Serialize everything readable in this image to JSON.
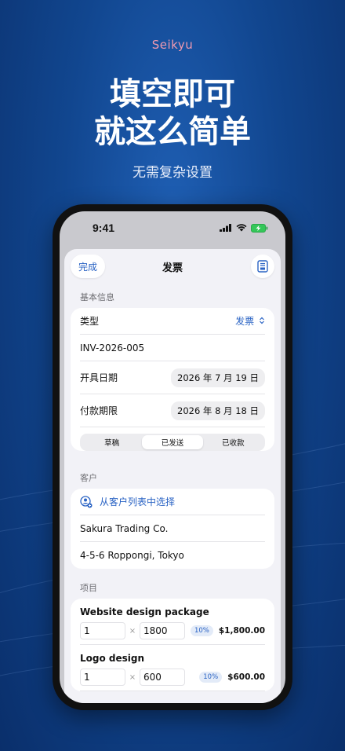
{
  "promo": {
    "brand": "Seikyu",
    "headline_line1": "填空即可",
    "headline_line2": "就这么简单",
    "subheadline": "无需复杂设置"
  },
  "status_bar": {
    "time": "9:41"
  },
  "nav": {
    "done_label": "完成",
    "title": "发票",
    "right_icon": "document-preview-icon"
  },
  "basic_info": {
    "section_label": "基本信息",
    "type_label": "类型",
    "type_value": "发票",
    "invoice_number": "INV-2026-005",
    "issue_date_label": "开具日期",
    "issue_date_value": "2026 年 7 月 19 日",
    "due_date_label": "付款期限",
    "due_date_value": "2026 年 8 月 18 日",
    "status_options": [
      "草稿",
      "已发送",
      "已收款"
    ],
    "status_selected": "已发送"
  },
  "customer": {
    "section_label": "客户",
    "select_from_list": "从客户列表中选择",
    "name": "Sakura Trading Co.",
    "address": "4-5-6 Roppongi, Tokyo"
  },
  "items": {
    "section_label": "项目",
    "list": [
      {
        "name": "Website design package",
        "quantity": "1",
        "unit_price": "1800",
        "tax": "10%",
        "total": "$1,800.00"
      },
      {
        "name": "Logo design",
        "quantity": "1",
        "unit_price": "600",
        "tax": "10%",
        "total": "$600.00"
      }
    ],
    "times_symbol": "×"
  },
  "colors": {
    "accent": "#2a63c4",
    "brand_pink": "#f09ab0",
    "background": "#11468f"
  }
}
